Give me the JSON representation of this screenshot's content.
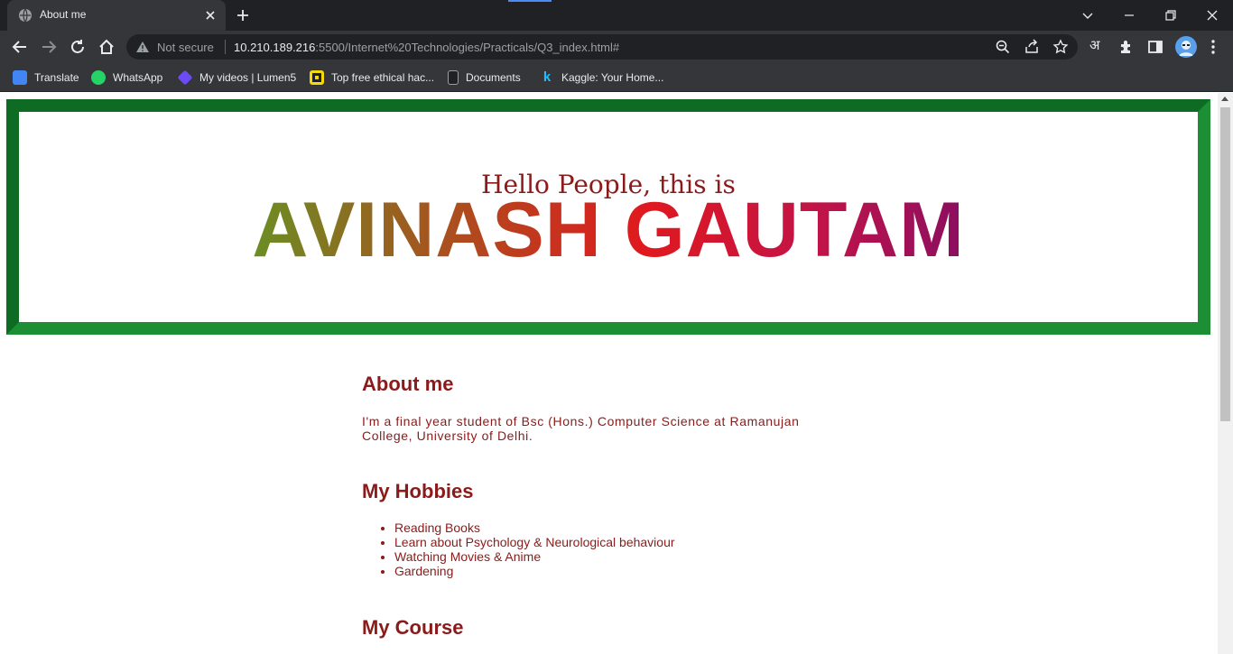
{
  "browser": {
    "tab_title": "About me",
    "address": {
      "security_label": "Not secure",
      "host": "10.210.189.216",
      "rest": ":5500/Internet%20Technologies/Practicals/Q3_index.html#"
    },
    "translate_glyph": "अ",
    "bookmarks": [
      {
        "label": "Translate",
        "icon": "google-translate-icon",
        "color": "#4285f4"
      },
      {
        "label": "WhatsApp",
        "icon": "whatsapp-icon",
        "color": "#25d366"
      },
      {
        "label": "My videos | Lumen5",
        "icon": "lumen5-icon",
        "color": "#6c4bf4"
      },
      {
        "label": "Top free ethical hac...",
        "icon": "hacking-site-icon",
        "color": "#f5d90a"
      },
      {
        "label": "Documents",
        "icon": "documents-icon",
        "color": "#202124"
      },
      {
        "label": "Kaggle: Your Home...",
        "icon": "kaggle-icon",
        "color": "#20beff"
      }
    ]
  },
  "page": {
    "greeting": "Hello People, this is",
    "name": "AVINASH GAUTAM",
    "about_heading": "About me",
    "about_text": "I'm a final year student of Bsc (Hons.) Computer Science at Ramanujan College, University of Delhi.",
    "hobbies_heading": "My Hobbies",
    "hobbies": [
      "Reading Books",
      "Learn about Psychology & Neurological behaviour",
      "Watching Movies & Anime",
      "Gardening"
    ],
    "course_heading": "My Course",
    "colors": {
      "text": "#8b1a1a",
      "border": "#1c8f35"
    }
  }
}
